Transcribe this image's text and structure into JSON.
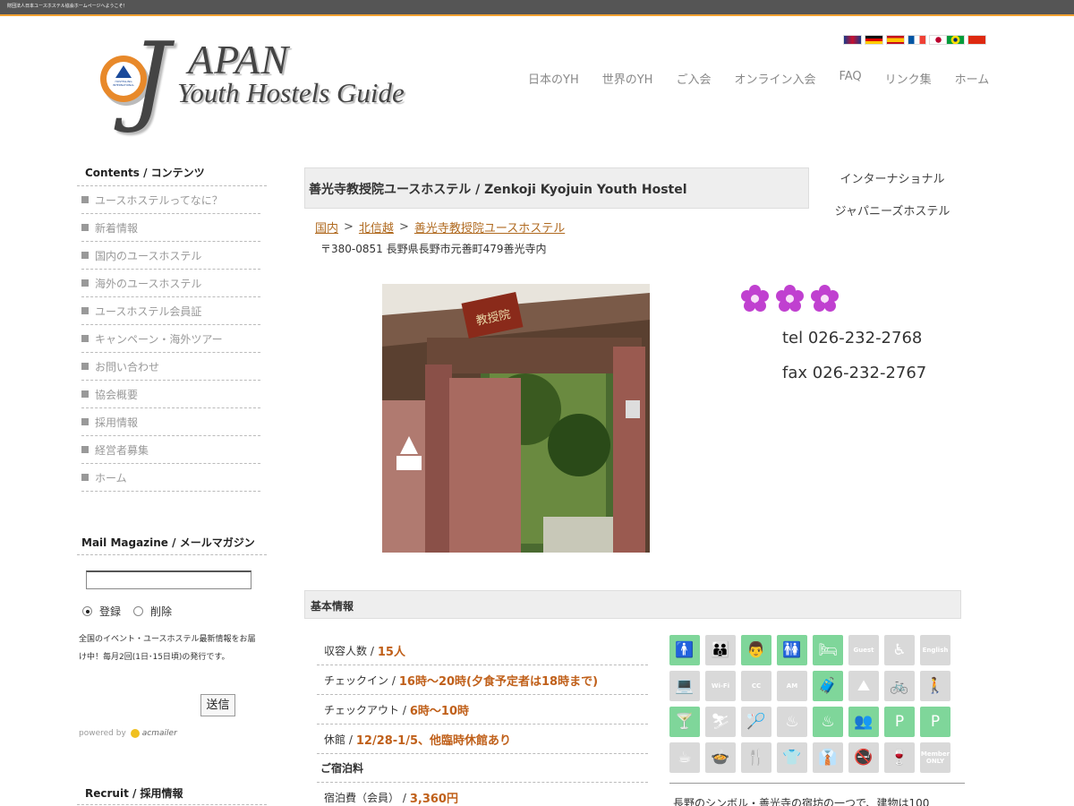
{
  "topbar": {
    "text": "財団法人日本ユースホステル協会ホームページへようこそ！"
  },
  "logo": {
    "letter": "J",
    "word": "APAN",
    "subtitle": "Youth Hostels Guide",
    "badge": "HOSTELLING INTERNATIONAL"
  },
  "flags": [
    {
      "name": "uk",
      "bg": "linear-gradient(90deg,#1a3a8a,#c8102e 50%,#1a3a8a)"
    },
    {
      "name": "de",
      "bg": "linear-gradient(#111 33%,#d00 33% 66%,#fc0 66%)"
    },
    {
      "name": "es",
      "bg": "linear-gradient(#c60b1e 25%,#ffc400 25% 75%,#c60b1e 75%)"
    },
    {
      "name": "fr",
      "bg": "linear-gradient(90deg,#0055a4 33%,#fff 33% 66%,#ef4135 66%)"
    },
    {
      "name": "jp",
      "bg": "radial-gradient(circle,#bc002d 30%,#fff 32%)"
    },
    {
      "name": "br",
      "bg": "radial-gradient(circle,#002776 20%,#ffdf00 22% 45%,#009c3b 47%)"
    },
    {
      "name": "cn",
      "bg": "#de2910"
    }
  ],
  "nav": [
    "日本のYH",
    "世界のYH",
    "ご入会",
    "オンライン入会",
    "FAQ",
    "リンク集",
    "ホーム"
  ],
  "sidebar": {
    "heading": "Contents / コンテンツ",
    "items": [
      "ユースホステルってなに？",
      "新着情報",
      "国内のユースホステル",
      "海外のユースホステル",
      "ユースホステル会員証",
      "キャンペーン・海外ツアー",
      "お問い合わせ",
      "協会概要",
      "採用情報",
      "経営者募集",
      "ホーム"
    ]
  },
  "mail": {
    "heading": "Mail Magazine / メールマガジン",
    "register": "登録",
    "delete": "削除",
    "desc": "全国のイベント・ユースホステル最新情報をお届け中！毎月2回(1日･15日頃)の発行です。",
    "send": "送信",
    "powered": "powered by",
    "acmailer": "acmailer"
  },
  "recruit": {
    "heading": "Recruit / 採用情報"
  },
  "main": {
    "title": "善光寺教授院ユースホステル / Zenkoji Kyojuin Youth Hostel",
    "side_links": [
      "インターナショナル",
      "ジャパニーズホステル"
    ],
    "breadcrumb": [
      "国内",
      "北信越",
      "善光寺教授院ユースホステル"
    ],
    "breadcrumb_sep": ">",
    "address": "〒380-0851 長野県長野市元善町479善光寺内",
    "rating": 3,
    "tel": "tel 026-232-2768",
    "fax": "fax 026-232-2767",
    "photo_sign": "教授院"
  },
  "info": {
    "heading": "基本情報",
    "rows": [
      {
        "label": "収容人数 /",
        "value": "15人"
      },
      {
        "label": "チェックイン /",
        "value": "16時〜20時(夕食予定者は18時まで)"
      },
      {
        "label": "チェックアウト /",
        "value": "6時〜10時"
      },
      {
        "label": "休館 /",
        "value": "12/28-1/5、他臨時休館あり"
      }
    ],
    "stay_heading": "ご宿泊料",
    "stay_row": {
      "label": "宿泊費（会員） /",
      "value": "3,360円"
    },
    "description": "長野のシンボル・善光寺の宿坊の一つで、建物は100"
  },
  "icons": [
    {
      "name": "single-room-icon",
      "on": true,
      "glyph": "🚹"
    },
    {
      "name": "dorm-room-icon",
      "on": false,
      "glyph": "👪"
    },
    {
      "name": "family-room-icon",
      "on": true,
      "glyph": "👨"
    },
    {
      "name": "mixed-room-icon",
      "on": true,
      "glyph": "🚻"
    },
    {
      "name": "bed-room-icon",
      "on": true,
      "glyph": "🛏"
    },
    {
      "name": "guest-house-icon",
      "on": false,
      "glyph": "Guest"
    },
    {
      "name": "wheelchair-icon",
      "on": false,
      "glyph": "♿"
    },
    {
      "name": "english-icon",
      "on": false,
      "glyph": "English"
    },
    {
      "name": "computer-icon",
      "on": false,
      "glyph": "💻"
    },
    {
      "name": "wifi-icon",
      "on": false,
      "glyph": "Wi-Fi"
    },
    {
      "name": "credit-card-icon",
      "on": false,
      "glyph": "CC"
    },
    {
      "name": "morning-icon",
      "on": false,
      "glyph": "AM"
    },
    {
      "name": "luggage-icon",
      "on": true,
      "glyph": "🧳"
    },
    {
      "name": "tour-icon",
      "on": false,
      "glyph": "⛰"
    },
    {
      "name": "bicycle-rental-icon",
      "on": false,
      "glyph": "🚲"
    },
    {
      "name": "hiking-icon",
      "on": false,
      "glyph": "🚶"
    },
    {
      "name": "bar-icon",
      "on": true,
      "glyph": "🍸"
    },
    {
      "name": "ski-icon",
      "on": false,
      "glyph": "⛷"
    },
    {
      "name": "sports-icon",
      "on": false,
      "glyph": "🏸"
    },
    {
      "name": "onsen-icon",
      "on": false,
      "glyph": "♨"
    },
    {
      "name": "onsen-home-icon",
      "on": true,
      "glyph": "♨"
    },
    {
      "name": "meeting-room-icon",
      "on": true,
      "glyph": "👥"
    },
    {
      "name": "bicycle-parking-icon",
      "on": true,
      "glyph": "P"
    },
    {
      "name": "car-parking-icon",
      "on": true,
      "glyph": "P"
    },
    {
      "name": "cafe-icon",
      "on": false,
      "glyph": "☕"
    },
    {
      "name": "kitchen-icon",
      "on": false,
      "glyph": "🍲"
    },
    {
      "name": "dining-icon",
      "on": false,
      "glyph": "🍴"
    },
    {
      "name": "coin-laundry-icon",
      "on": false,
      "glyph": "👕"
    },
    {
      "name": "laundry-icon",
      "on": false,
      "glyph": "👔"
    },
    {
      "name": "no-smoking-icon",
      "on": false,
      "glyph": "🚭"
    },
    {
      "name": "no-alcohol-icon",
      "on": false,
      "glyph": "🍷"
    },
    {
      "name": "member-only-icon",
      "on": false,
      "glyph": "Member ONLY"
    }
  ]
}
